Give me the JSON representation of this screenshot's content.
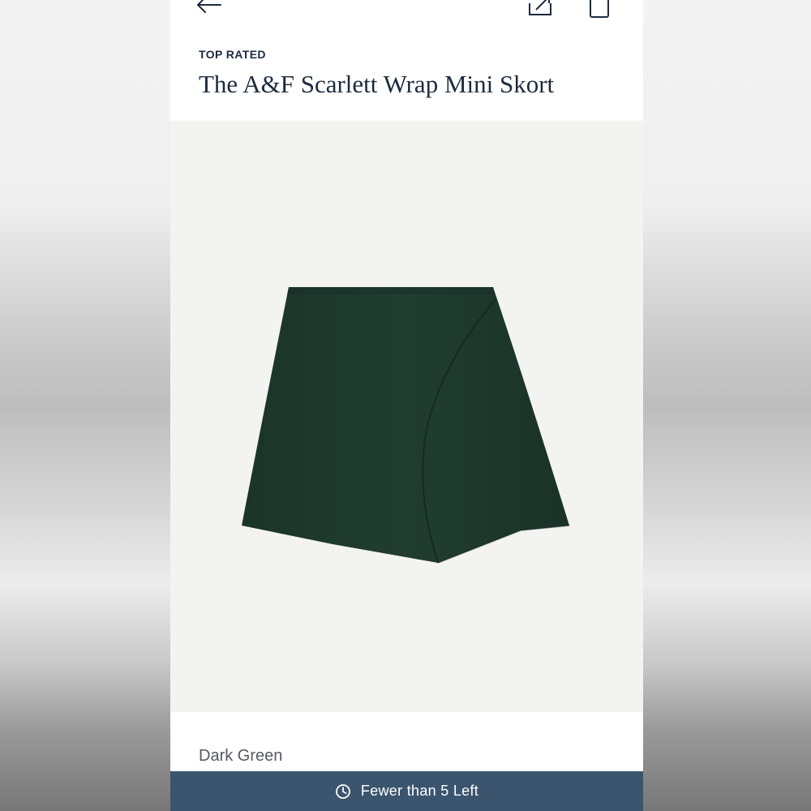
{
  "header": {
    "back_icon": "arrow-left-icon",
    "share_icon": "share-icon",
    "bag_icon": "shopping-bag-icon"
  },
  "product": {
    "badge": "TOP RATED",
    "title": "The A&F Scarlett Wrap Mini Skort",
    "image": "dark-green-skort-photo",
    "color": "Dark Green"
  },
  "stock": {
    "icon": "clock-icon",
    "text": "Fewer than 5 Left"
  },
  "colors": {
    "navy_text": "#1c2b3e",
    "bar_bg": "#3b556e",
    "skort_green": "#1f3a2e"
  }
}
